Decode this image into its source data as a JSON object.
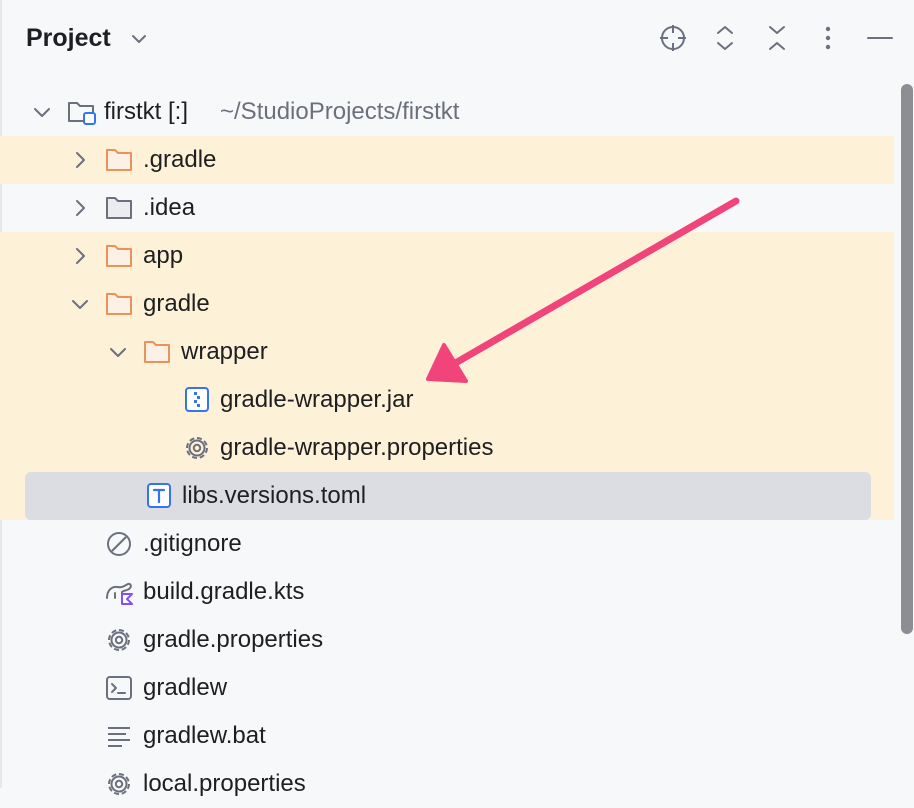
{
  "panel": {
    "title": "Project",
    "toolbar": {
      "locate_icon": "crosshair-icon",
      "expand_icon": "expand-all-icon",
      "collapse_icon": "collapse-all-icon",
      "options_icon": "more-vertical-icon",
      "hide_icon": "minimize-icon"
    }
  },
  "tree": {
    "root": {
      "name": "firstkt [:]",
      "path": "~/StudioProjects/firstkt",
      "icon": "module-folder-icon"
    },
    "items": [
      {
        "label": ".gradle",
        "icon": "folder-orange-icon"
      },
      {
        "label": ".idea",
        "icon": "folder-gray-icon"
      },
      {
        "label": "app",
        "icon": "folder-orange-icon"
      },
      {
        "label": "gradle",
        "icon": "folder-orange-icon"
      },
      {
        "label": "wrapper",
        "icon": "folder-orange-icon"
      },
      {
        "label": "gradle-wrapper.jar",
        "icon": "jar-archive-icon"
      },
      {
        "label": "gradle-wrapper.properties",
        "icon": "gear-icon"
      },
      {
        "label": "libs.versions.toml",
        "icon": "toml-text-icon"
      },
      {
        "label": ".gitignore",
        "icon": "ignore-icon"
      },
      {
        "label": "build.gradle.kts",
        "icon": "gradle-kotlin-icon"
      },
      {
        "label": "gradle.properties",
        "icon": "gear-icon"
      },
      {
        "label": "gradlew",
        "icon": "terminal-icon"
      },
      {
        "label": "gradlew.bat",
        "icon": "text-lines-icon"
      },
      {
        "label": "local.properties",
        "icon": "gear-icon"
      }
    ]
  },
  "colors": {
    "highlight_row": "#fdf2d8",
    "selected_row": "#dbdde2",
    "folder_orange": "#e8935b",
    "annotation_arrow": "#f0447a"
  }
}
